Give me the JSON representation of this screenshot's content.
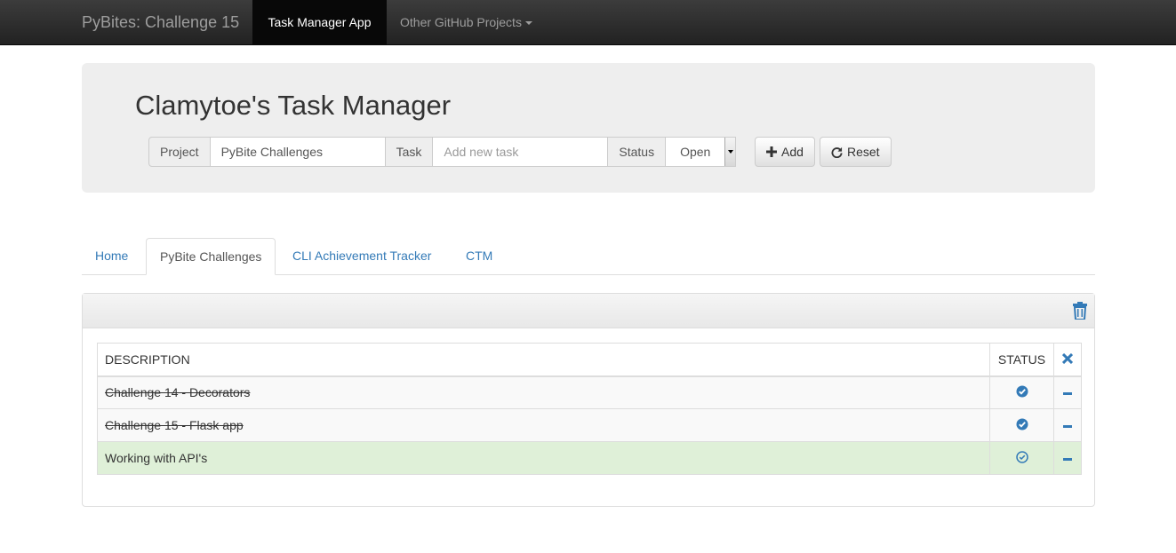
{
  "navbar": {
    "brand": "PyBites: Challenge 15",
    "active_item": "Task Manager App",
    "dropdown_label": "Other GitHub Projects"
  },
  "jumbotron": {
    "title": "Clamytoe's Task Manager",
    "form": {
      "project_label": "Project",
      "project_value": "PyBite Challenges",
      "task_label": "Task",
      "task_placeholder": "Add new task",
      "status_label": "Status",
      "status_value": "Open",
      "add_button": "Add",
      "reset_button": "Reset"
    }
  },
  "tabs": [
    {
      "label": "Home",
      "active": false
    },
    {
      "label": "PyBite Challenges",
      "active": true
    },
    {
      "label": "CLI Achievement Tracker",
      "active": false
    },
    {
      "label": "CTM",
      "active": false
    }
  ],
  "table": {
    "headers": {
      "description": "DESCRIPTION",
      "status": "STATUS"
    },
    "rows": [
      {
        "description": "Challenge 14 - Decorators",
        "done": true,
        "status_icon": "check-circle-filled-icon"
      },
      {
        "description": "Challenge 15 - Flask app",
        "done": true,
        "status_icon": "check-circle-filled-icon"
      },
      {
        "description": "Working with API's",
        "done": false,
        "status_icon": "check-circle-outline-icon"
      }
    ]
  },
  "colors": {
    "link": "#337ab7",
    "navbar_bg": "#222222",
    "success_row": "#dff0d8"
  }
}
